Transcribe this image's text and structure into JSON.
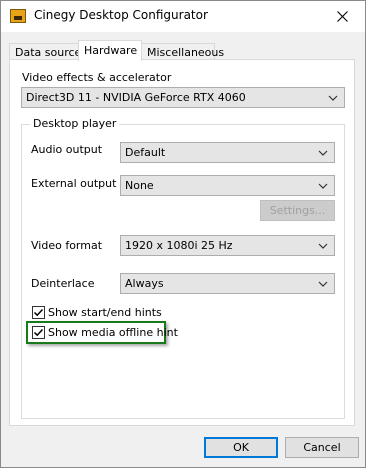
{
  "window": {
    "title": "Cinegy Desktop Configurator"
  },
  "tabs": [
    {
      "label": "Data source",
      "active": false
    },
    {
      "label": "Hardware",
      "active": true
    },
    {
      "label": "Miscellaneous",
      "active": false
    }
  ],
  "hardware": {
    "video_effects_label": "Video effects & accelerator",
    "video_effects_value": "Direct3D 11 - NVIDIA GeForce RTX 4060",
    "desktop_player": {
      "group_title": "Desktop player",
      "audio_output_label": "Audio output",
      "audio_output_value": "Default",
      "external_output_label": "External output",
      "external_output_value": "None",
      "settings_button": "Settings...",
      "video_format_label": "Video format",
      "video_format_value": "1920 x 1080i 25 Hz",
      "deinterlace_label": "Deinterlace",
      "deinterlace_value": "Always",
      "show_hints_label": "Show start/end hints",
      "show_hints_checked": true,
      "show_offline_label": "Show media offline hint",
      "show_offline_checked": true
    }
  },
  "buttons": {
    "ok": "OK",
    "cancel": "Cancel"
  },
  "colors": {
    "highlight": "#1a7a1a",
    "accent": "#0078d7",
    "app_icon": "#e8a317"
  },
  "icons": {
    "app": "cinegy-app-icon",
    "close": "close-icon",
    "combo_arrow": "chevron-down-icon",
    "checkbox": "checkmark-icon"
  }
}
